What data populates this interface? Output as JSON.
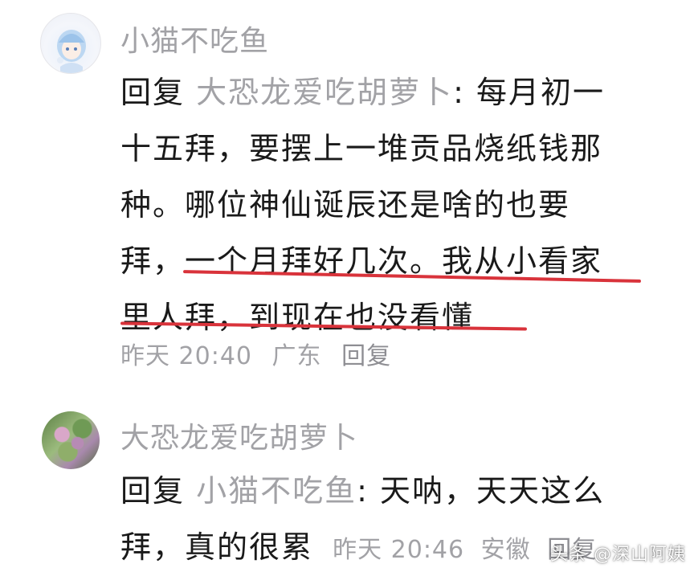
{
  "comments": [
    {
      "username": "小猫不吃鱼",
      "reply_prefix": "回复",
      "reply_to": "大恐龙爱吃胡萝卜",
      "lines": [
        ": 每月初一",
        "十五拜，要摆上一堆贡品烧纸钱那",
        "种。哪位神仙诞辰还是啥的也要",
        "拜，一个月拜好几次。我从小看家",
        "里人拜，到现在也没看懂"
      ],
      "time": "昨天 20:40",
      "location": "广东",
      "reply_label": "回复"
    },
    {
      "username": "大恐龙爱吃胡萝卜",
      "reply_prefix": "回复",
      "reply_to": "小猫不吃鱼",
      "lines": [
        ": 天呐，天天这么",
        "拜，真的很累"
      ],
      "time": "昨天 20:46",
      "location": "安徽",
      "reply_label": "回复"
    }
  ],
  "watermark": "头条 @深山阿姨",
  "highlight_color": "#d9333b"
}
